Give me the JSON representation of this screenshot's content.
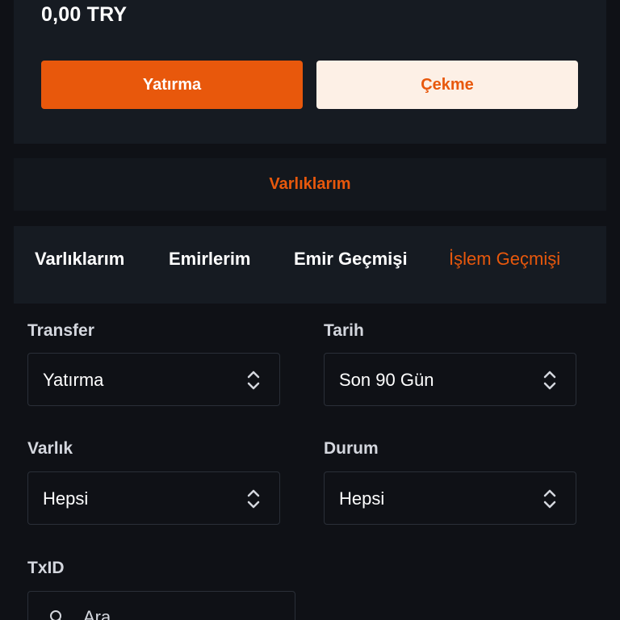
{
  "balance": {
    "amount": "0,00 TRY"
  },
  "actions": {
    "deposit_label": "Yatırma",
    "withdraw_label": "Çekme"
  },
  "assets_banner": {
    "label": "Varlıklarım"
  },
  "tabs": [
    {
      "label": "Varlıklarım",
      "active": false
    },
    {
      "label": "Emirlerim",
      "active": false
    },
    {
      "label": "Emir Geçmişi",
      "active": false
    },
    {
      "label": "İşlem Geçmişi",
      "active": true
    }
  ],
  "filters": {
    "transfer": {
      "label": "Transfer",
      "value": "Yatırma"
    },
    "date": {
      "label": "Tarih",
      "value": "Son 90 Gün"
    },
    "asset": {
      "label": "Varlık",
      "value": "Hepsi"
    },
    "status": {
      "label": "Durum",
      "value": "Hepsi"
    },
    "txid": {
      "label": "TxID",
      "placeholder": "Ara"
    }
  },
  "icons": {
    "select_arrow": "chevron-up-down-icon",
    "search": "search-icon"
  },
  "colors": {
    "accent": "#e8580c",
    "background": "#0f1116",
    "card": "#161b22",
    "withdraw_bg": "#fdf0e6"
  }
}
